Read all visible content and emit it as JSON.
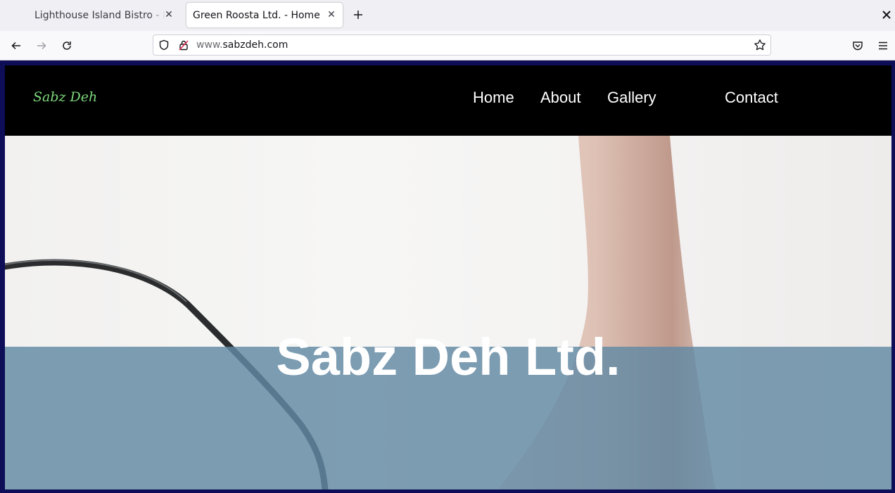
{
  "browser": {
    "tabs": [
      {
        "title": "Lighthouse Island Bistro - Home",
        "active": false
      },
      {
        "title": "Green Roosta Ltd. - Home",
        "active": true
      }
    ],
    "url_prefix": "www.",
    "url_domain": "sabzdeh.com"
  },
  "site": {
    "logo": "Sabz Deh",
    "nav": [
      "Home",
      "About",
      "Gallery",
      "Contact"
    ],
    "hero_title": "Sabz Deh Ltd."
  },
  "colors": {
    "header_bg": "#000000",
    "logo": "#7dd87d",
    "hero_band": "#6289a3",
    "viewport_border": "#0d0d58"
  }
}
